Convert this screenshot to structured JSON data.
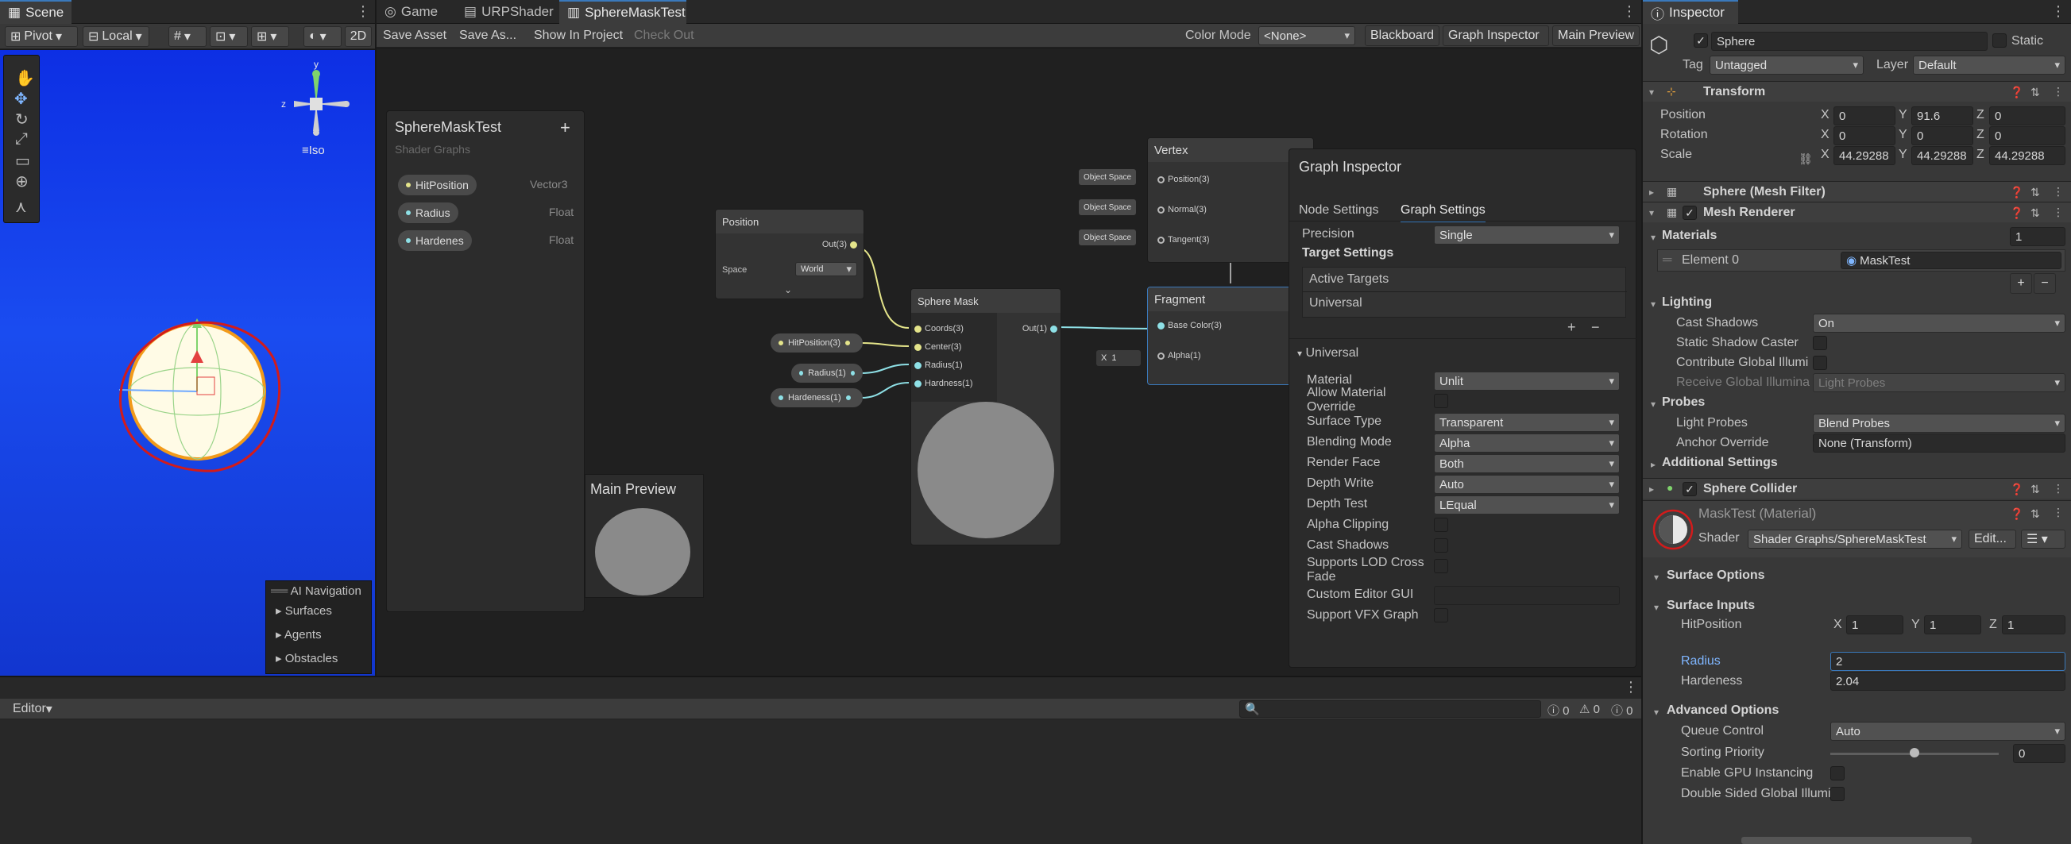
{
  "scene": {
    "tab": "Scene",
    "pivot": "Pivot",
    "local": "Local",
    "mode_2d": "2D",
    "iso": "Iso",
    "ai_nav": {
      "title": "AI Navigation",
      "items": [
        "Surfaces",
        "Agents",
        "Obstacles"
      ]
    },
    "axis_labels": {
      "x": "x",
      "y": "y",
      "z": "z"
    }
  },
  "center_tabs": [
    "Game",
    "URPShader",
    "SphereMaskTest"
  ],
  "graph_toolbar": {
    "save_asset": "Save Asset",
    "save_as": "Save As...",
    "show_in_project": "Show In Project",
    "check_out": "Check Out",
    "color_mode_label": "Color Mode",
    "color_mode_value": "<None>",
    "blackboard": "Blackboard",
    "graph_inspector": "Graph Inspector",
    "main_preview": "Main Preview"
  },
  "blackboard": {
    "title": "SphereMaskTest",
    "subtitle": "Shader Graphs",
    "add": "+",
    "properties": [
      {
        "name": "HitPosition",
        "type": "Vector3"
      },
      {
        "name": "Radius",
        "type": "Float"
      },
      {
        "name": "Hardenes",
        "type": "Float"
      }
    ]
  },
  "main_preview_title": "Main Preview",
  "nodes": {
    "position": {
      "title": "Position",
      "out": "Out(3)",
      "space_label": "Space",
      "space_value": "World"
    },
    "sphere_mask": {
      "title": "Sphere Mask",
      "inputs": [
        "Coords(3)",
        "Center(3)",
        "Radius(1)",
        "Hardness(1)"
      ],
      "out": "Out(1)"
    },
    "vertex": {
      "title": "Vertex",
      "inputs": [
        "Position(3)",
        "Normal(3)",
        "Tangent(3)"
      ],
      "space": "Object Space"
    },
    "fragment": {
      "title": "Fragment",
      "inputs": [
        "Base Color(3)",
        "Alpha(1)"
      ],
      "alpha_x": "X",
      "alpha_val": "1"
    },
    "props": [
      "HitPosition(3)",
      "Radius(1)",
      "Hardeness(1)"
    ]
  },
  "graph_inspector": {
    "title": "Graph Inspector",
    "tabs": [
      "Node Settings",
      "Graph Settings"
    ],
    "precision_label": "Precision",
    "precision_value": "Single",
    "target_settings": "Target Settings",
    "active_targets": "Active Targets",
    "target": "Universal",
    "universal": "Universal",
    "rows": [
      {
        "label": "Material",
        "value": "Unlit",
        "kind": "dd"
      },
      {
        "label": "Allow Material Override",
        "kind": "chk"
      },
      {
        "label": "Surface Type",
        "value": "Transparent",
        "kind": "dd"
      },
      {
        "label": "Blending Mode",
        "value": "Alpha",
        "kind": "dd"
      },
      {
        "label": "Render Face",
        "value": "Both",
        "kind": "dd"
      },
      {
        "label": "Depth Write",
        "value": "Auto",
        "kind": "dd"
      },
      {
        "label": "Depth Test",
        "value": "LEqual",
        "kind": "dd"
      },
      {
        "label": "Alpha Clipping",
        "kind": "chk"
      },
      {
        "label": "Cast Shadows",
        "kind": "chk"
      },
      {
        "label": "Supports LOD Cross Fade",
        "kind": "chk"
      },
      {
        "label": "Custom Editor GUI",
        "kind": "field"
      },
      {
        "label": "Support VFX Graph",
        "kind": "chk"
      }
    ]
  },
  "console": {
    "editor": "Editor",
    "counts": [
      "0",
      "0",
      "0"
    ]
  },
  "inspector": {
    "tab": "Inspector",
    "object_name": "Sphere",
    "static": "Static",
    "tag_label": "Tag",
    "tag_value": "Untagged",
    "layer_label": "Layer",
    "layer_value": "Default",
    "transform": {
      "title": "Transform",
      "rows": [
        {
          "label": "Position",
          "x": "0",
          "y": "91.6",
          "z": "0"
        },
        {
          "label": "Rotation",
          "x": "0",
          "y": "0",
          "z": "0"
        },
        {
          "label": "Scale",
          "x": "44.29288",
          "y": "44.29288",
          "z": "44.29288"
        }
      ]
    },
    "mesh_filter": "Sphere (Mesh Filter)",
    "mesh_renderer": "Mesh Renderer",
    "materials_label": "Materials",
    "materials_count": "1",
    "element0_label": "Element 0",
    "element0_value": "MaskTest",
    "lighting": "Lighting",
    "cast_shadows_label": "Cast Shadows",
    "cast_shadows_value": "On",
    "static_shadow_caster": "Static Shadow Caster",
    "contribute_gi": "Contribute Global Illumi",
    "receive_gi_label": "Receive Global Illumina",
    "receive_gi_value": "Light Probes",
    "probes": "Probes",
    "light_probes_label": "Light Probes",
    "light_probes_value": "Blend Probes",
    "anchor_override_label": "Anchor Override",
    "anchor_override_value": "None (Transform)",
    "additional_settings": "Additional Settings",
    "sphere_collider": "Sphere Collider",
    "material_title": "MaskTest (Material)",
    "shader_label": "Shader",
    "shader_value": "Shader Graphs/SphereMaskTest",
    "edit": "Edit...",
    "surface_options": "Surface Options",
    "surface_inputs": "Surface Inputs",
    "hitposition_label": "HitPosition",
    "hit": {
      "x": "1",
      "y": "1",
      "z": "1"
    },
    "radius_label": "Radius",
    "radius_value": "2",
    "hardeness_label": "Hardeness",
    "hardeness_value": "2.04",
    "advanced_options": "Advanced Options",
    "queue_control_label": "Queue Control",
    "queue_control_value": "Auto",
    "sorting_priority_label": "Sorting Priority",
    "sorting_priority_value": "0",
    "gpu_instancing": "Enable GPU Instancing",
    "double_sided_gi": "Double Sided Global Illumi"
  }
}
